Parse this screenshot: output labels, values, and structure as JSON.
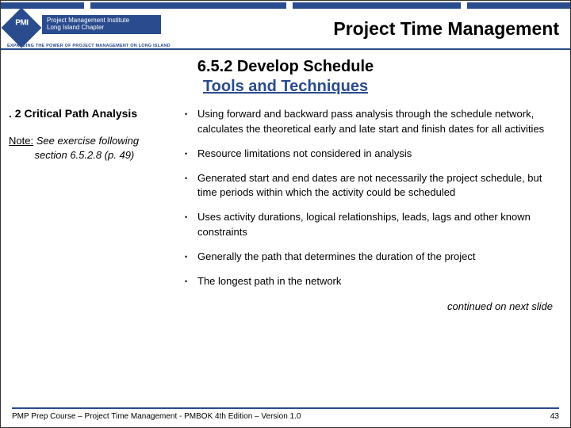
{
  "header": {
    "logo_abbr": "PMI",
    "logo_line1": "Project Management Institute",
    "logo_line2": "Long Island Chapter",
    "logo_tagline": "EXPANDING THE POWER OF PROJECT MANAGEMENT ON LONG ISLAND",
    "page_title": "Project Time Management"
  },
  "subtitle": {
    "line1": "6.5.2  Develop Schedule",
    "line2": "Tools and Techniques"
  },
  "left": {
    "topic": ". 2 Critical Path Analysis",
    "note_label": "Note:",
    "note_body1": "See exercise following",
    "note_body2": "section 6.5.2.8 (p. 49)"
  },
  "bullets": [
    "Using forward and backward pass analysis through the schedule network, calculates the theoretical early and late start and finish dates for all activities",
    "Resource limitations not considered in analysis",
    "Generated start and end dates are not necessarily the project schedule, but time periods within which the activity could be scheduled",
    "Uses activity durations, logical relationships, leads, lags and other known constraints",
    "Generally the path that determines the duration of the project",
    "The longest path in the network"
  ],
  "continued": "continued on next slide",
  "footer": {
    "left": "PMP Prep Course – Project Time Management - PMBOK 4th Edition – Version 1.0",
    "right": "43"
  }
}
